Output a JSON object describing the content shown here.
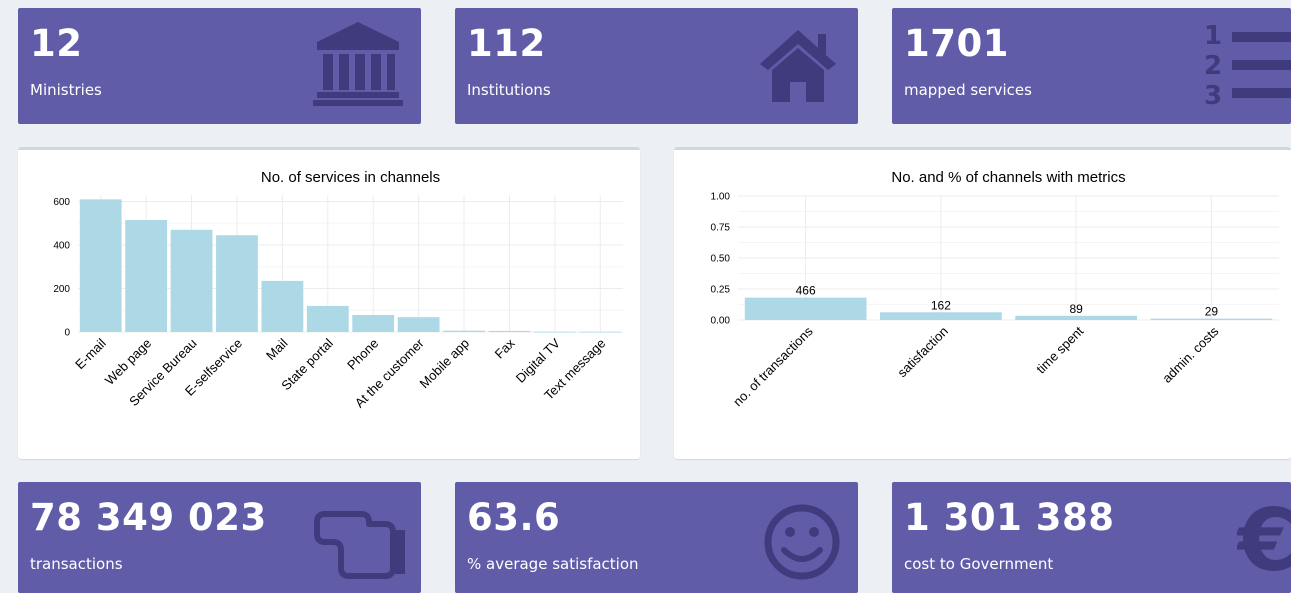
{
  "top_boxes": [
    {
      "value": "12",
      "label": "Ministries",
      "icon": "bank-icon"
    },
    {
      "value": "112",
      "label": "Institutions",
      "icon": "home-icon"
    },
    {
      "value": "1701",
      "label": "mapped services",
      "icon": "list-ol-icon"
    }
  ],
  "bottom_boxes": [
    {
      "value": "78 349 023",
      "label": "transactions",
      "icon": "hand-pointer-icon"
    },
    {
      "value": "63.6",
      "label": "% average satisfaction",
      "icon": "smile-icon"
    },
    {
      "value": "1 301 388",
      "label": "cost to Government",
      "icon": "euro-icon"
    }
  ],
  "colors": {
    "box_bg": "#605ca8",
    "icon": "#3f3b7d",
    "bar": "#add8e6",
    "page_bg": "#ecf0f5"
  },
  "chart_data": [
    {
      "type": "bar",
      "title": "No. of services in channels",
      "categories": [
        "E-mail",
        "Web page",
        "Service Bureau",
        "E-selfservice",
        "Mail",
        "State portal",
        "Phone",
        "At the customer",
        "Mobile app",
        "Fax",
        "Digital TV",
        "Text message"
      ],
      "values": [
        610,
        515,
        470,
        445,
        235,
        120,
        78,
        68,
        6,
        5,
        1,
        1
      ],
      "yticks": [
        "0",
        "200",
        "400",
        "600"
      ],
      "ylim": [
        0,
        630
      ],
      "grid": true
    },
    {
      "type": "bar",
      "title": "No. and % of channels with metrics",
      "categories": [
        "no. of transactions",
        "satisfaction",
        "time spent",
        "admin. costs"
      ],
      "values": [
        0.18,
        0.062,
        0.034,
        0.011
      ],
      "labels": [
        "466",
        "162",
        "89",
        "29"
      ],
      "yticks": [
        "0.00",
        "0.25",
        "0.50",
        "0.75",
        "1.00"
      ],
      "ylim": [
        0,
        1
      ],
      "grid": true
    }
  ]
}
